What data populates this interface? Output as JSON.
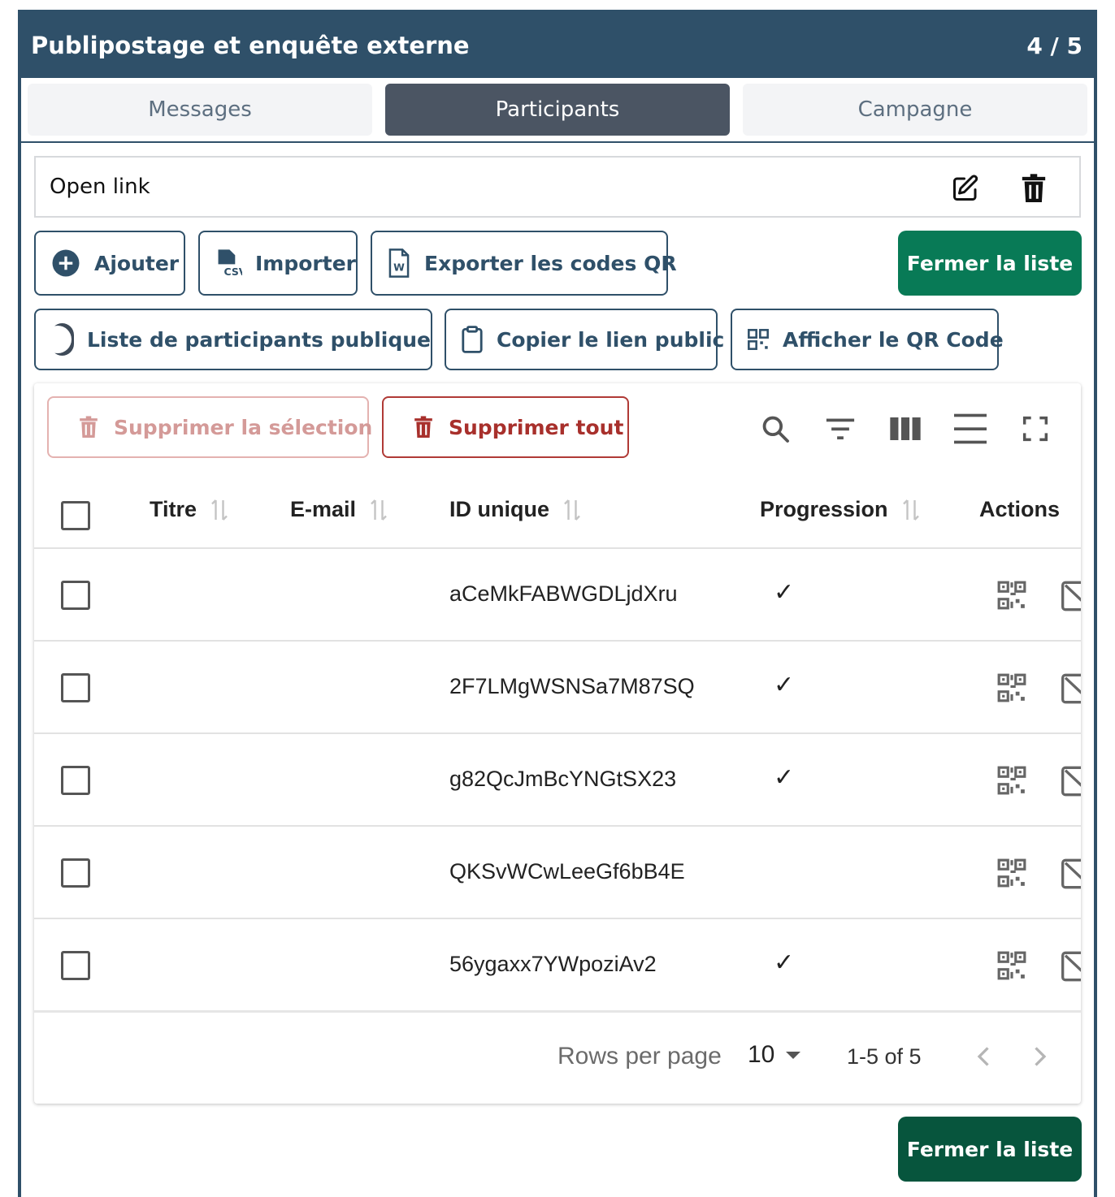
{
  "header": {
    "title": "Publipostage et enquête externe",
    "step": "4 / 5"
  },
  "tabs": [
    {
      "label": "Messages",
      "active": false
    },
    {
      "label": "Participants",
      "active": true
    },
    {
      "label": "Campagne",
      "active": false
    }
  ],
  "list": {
    "name": "Open link"
  },
  "toolbar": {
    "add_label": "Ajouter",
    "import_label": "Importer",
    "export_qr_label": "Exporter les codes QR",
    "close_label": "Fermer la liste",
    "public_toggle_label": "Liste de participants publique",
    "public_toggle_on": true,
    "copy_link_label": "Copier le lien public",
    "show_qr_label": "Afficher le QR Code"
  },
  "table": {
    "delete_selection_label": "Supprimer la sélection",
    "delete_all_label": "Supprimer tout",
    "columns": [
      "Titre",
      "E-mail",
      "ID unique",
      "Progression",
      "Actions"
    ],
    "rows": [
      {
        "title": "",
        "email": "",
        "id": "aCeMkFABWGDLjdXru",
        "progress": "✓"
      },
      {
        "title": "",
        "email": "",
        "id": "2F7LMgWSNSa7M87SQ",
        "progress": "✓"
      },
      {
        "title": "",
        "email": "",
        "id": "g82QcJmBcYNGtSX23",
        "progress": "✓"
      },
      {
        "title": "",
        "email": "",
        "id": "QKSvWCwLeeGf6bB4E",
        "progress": ""
      },
      {
        "title": "",
        "email": "",
        "id": "56ygaxx7YWpoziAv2",
        "progress": "✓"
      }
    ],
    "pagination": {
      "rows_per_page_label": "Rows per page",
      "rows_per_page": "10",
      "range": "1-5 of 5"
    }
  },
  "footer": {
    "close_label": "Fermer la liste"
  },
  "colors": {
    "header": "#2f5069",
    "primary_green": "#087a56",
    "danger": "#a8302c"
  }
}
